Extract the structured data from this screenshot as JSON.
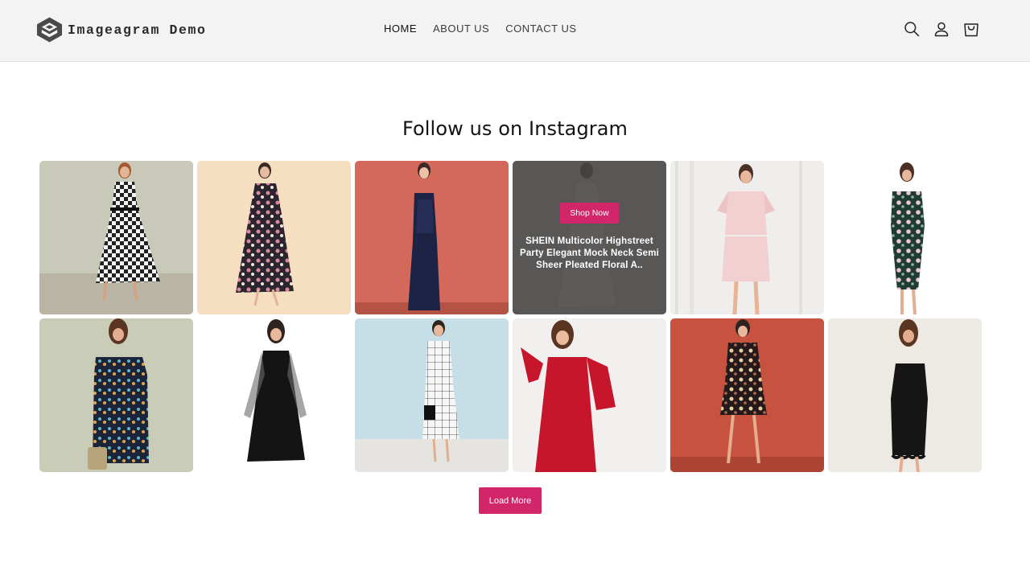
{
  "header": {
    "logo_text": "Imageagram Demo",
    "nav": [
      {
        "label": "HOME",
        "active": true
      },
      {
        "label": "ABOUT US",
        "active": false
      },
      {
        "label": "CONTACT US",
        "active": false
      }
    ],
    "icons": [
      "search-icon",
      "account-icon",
      "cart-icon"
    ]
  },
  "section": {
    "title": "Follow us on Instagram",
    "hover_overlay": {
      "button_label": "Shop Now",
      "product_title": "SHEIN Multicolor Highstreet Party Elegant Mock Neck Semi Sheer Pleated Floral A.."
    },
    "posts": [
      {
        "subject": "gingham-dress-photo",
        "bg": "#c9c9b9"
      },
      {
        "subject": "floral-cold-shoulder-dress-photo",
        "bg": "#f5dfc0"
      },
      {
        "subject": "sequin-gown-photo",
        "bg": "#d4685a"
      },
      {
        "subject": "floral-mock-neck-dress-photo",
        "bg": "#bdb6ad"
      },
      {
        "subject": "pink-lace-dress-photo",
        "bg": "#efeeec"
      },
      {
        "subject": "floral-bodycon-dress-photo",
        "bg": "#ffffff"
      },
      {
        "subject": "off-shoulder-floral-dress-photo",
        "bg": "#c9ccb7"
      },
      {
        "subject": "black-mesh-sleeve-dress-photo",
        "bg": "#ffffff"
      },
      {
        "subject": "grid-print-dress-photo",
        "bg": "#c6dfe6"
      },
      {
        "subject": "red-ruffle-sleeve-dress-photo",
        "bg": "#f2f0ee"
      },
      {
        "subject": "floral-wrap-dress-photo",
        "bg": "#c85240"
      },
      {
        "subject": "black-scallop-dress-photo",
        "bg": "#ede9e3"
      }
    ],
    "load_more_label": "Load More"
  },
  "colors": {
    "accent": "#d12669",
    "header_bg": "#f3f3f3",
    "overlay": "#464646"
  }
}
